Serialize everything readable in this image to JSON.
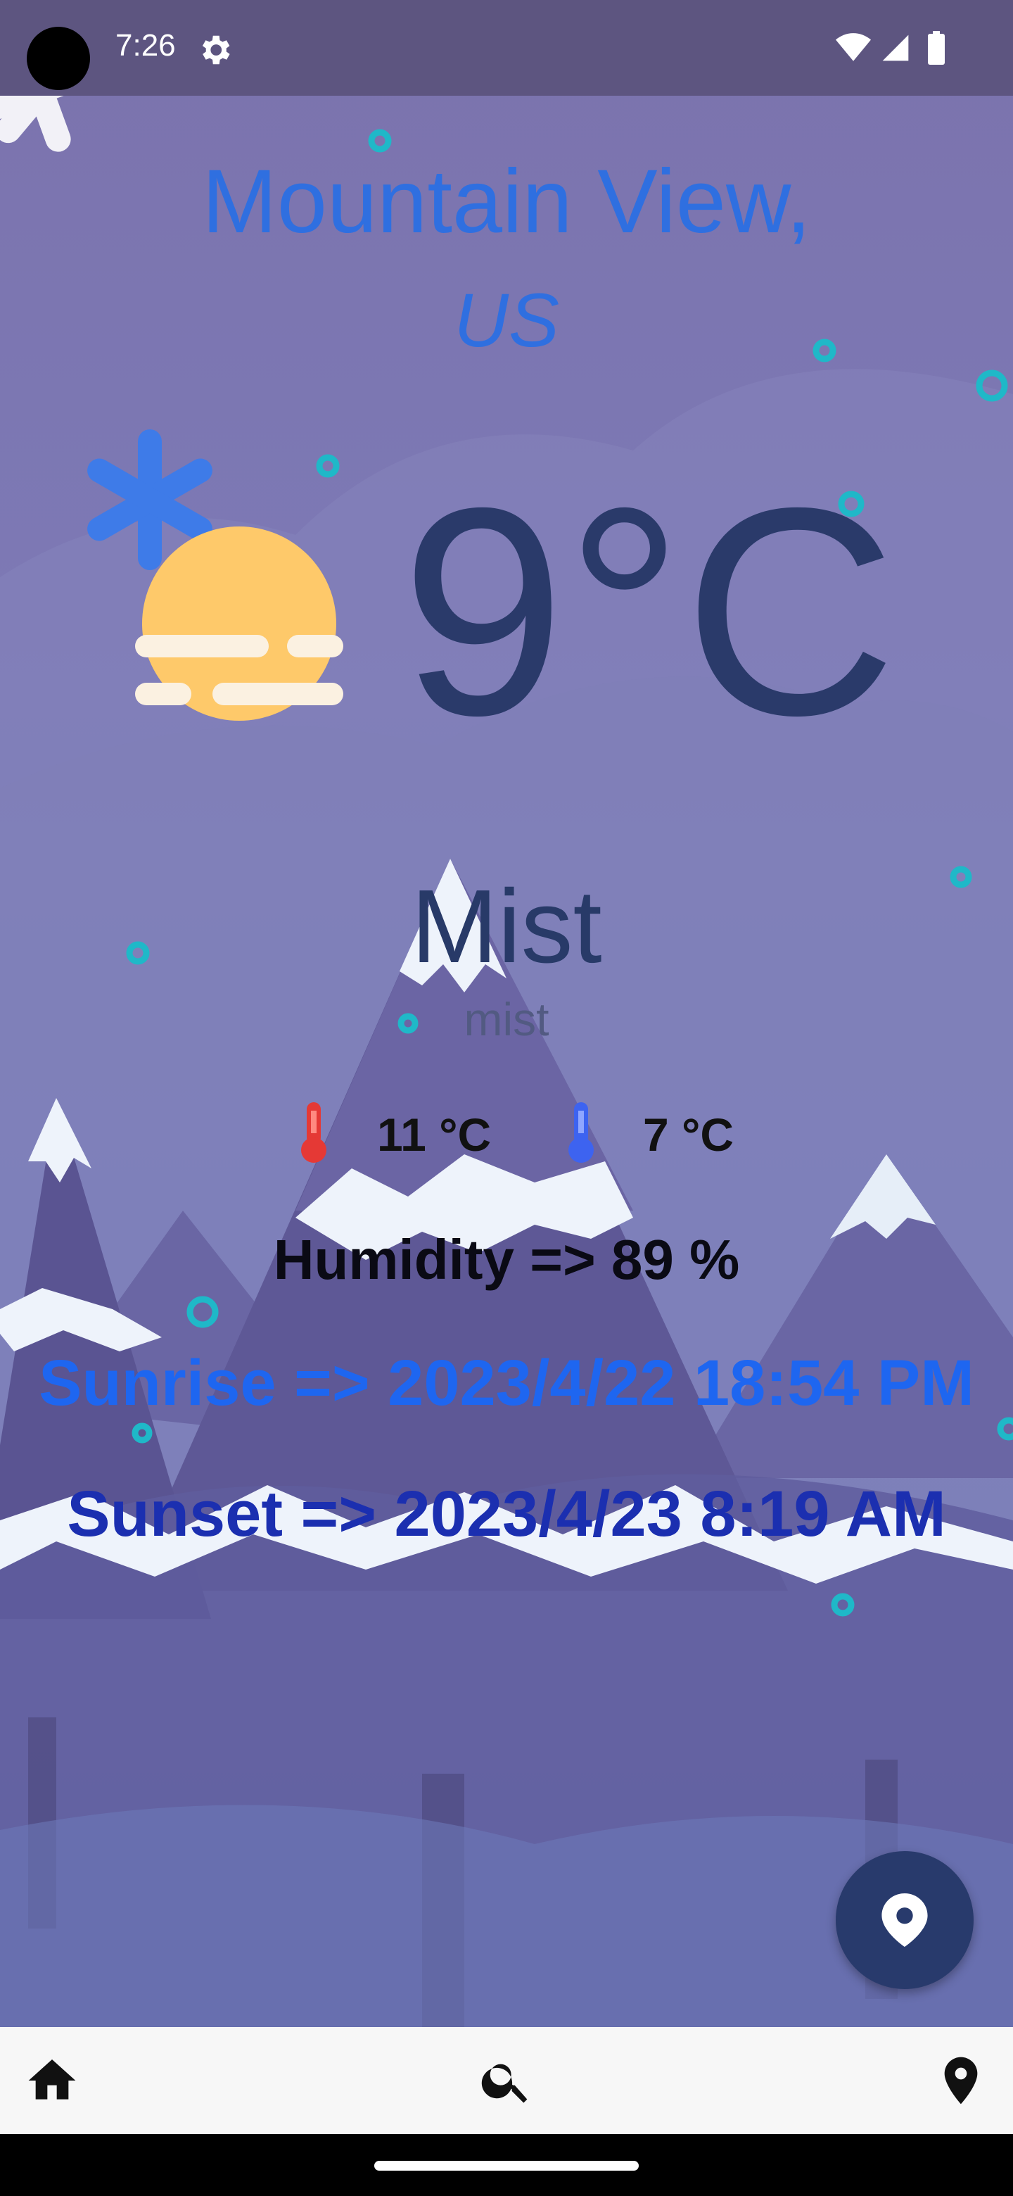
{
  "status_bar": {
    "time": "7:26"
  },
  "location": {
    "city": "Mountain View,",
    "country": "US"
  },
  "weather": {
    "temperature": "9°C",
    "main": "Mist",
    "description": "mist",
    "max_temp": "11 °C",
    "min_temp": "7 °C",
    "humidity": "Humidity => 89 %",
    "sunrise": "Sunrise => 2023/4/22 18:54 PM",
    "sunset": "Sunset => 2023/4/23 8:19 AM"
  },
  "icons": {
    "weather": "mist-sun-icon",
    "fab": "location-pin-icon",
    "nav": [
      "home-icon",
      "search-icon",
      "location-pin-icon"
    ]
  },
  "colors": {
    "city": "#2f6fe0",
    "temperature": "#2a3a6a",
    "sunrise": "#1e66f0",
    "sunset": "#1b2fb0",
    "max_thermometer": "#e53935",
    "min_thermometer": "#3d63f0",
    "fab": "#283a6c"
  }
}
